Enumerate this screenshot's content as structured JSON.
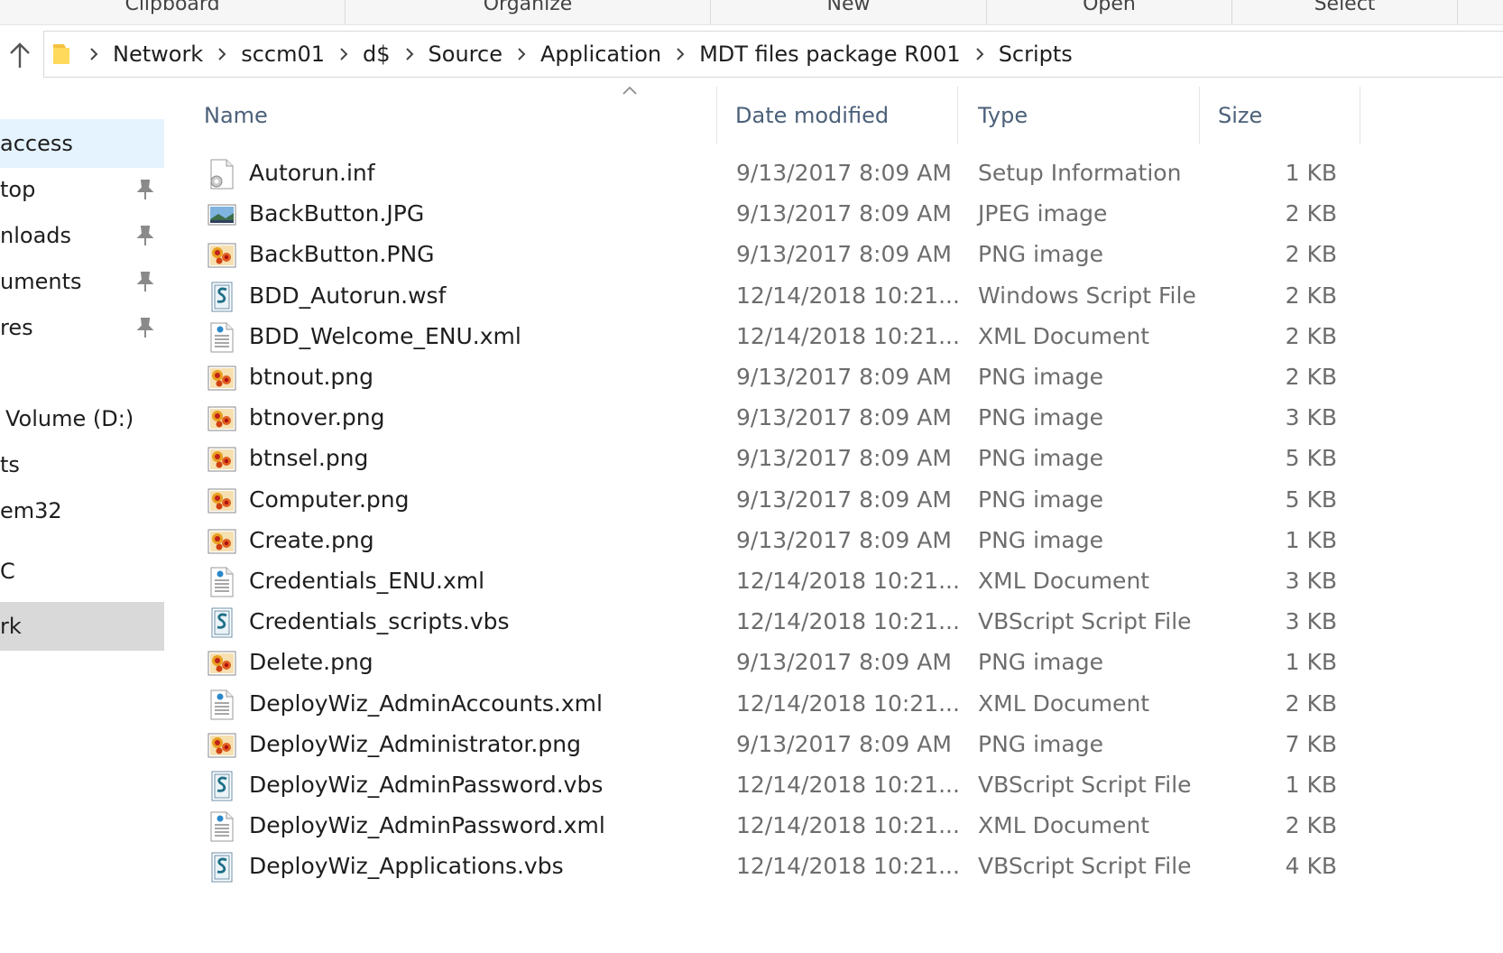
{
  "ribbon": {
    "groups": [
      "Clipboard",
      "Organize",
      "New",
      "Open",
      "Select"
    ]
  },
  "address": {
    "crumbs": [
      "Network",
      "sccm01",
      "d$",
      "Source",
      "Application",
      "MDT files package R001",
      "Scripts"
    ]
  },
  "navpane": {
    "items": [
      {
        "label": "access",
        "pinned": false,
        "state": "hover"
      },
      {
        "label": "top",
        "pinned": true,
        "state": ""
      },
      {
        "label": "nloads",
        "pinned": true,
        "state": ""
      },
      {
        "label": "uments",
        "pinned": true,
        "state": ""
      },
      {
        "label": "res",
        "pinned": true,
        "state": ""
      },
      {
        "label": "Volume (D:)",
        "pinned": false,
        "state": ""
      },
      {
        "label": "ts",
        "pinned": false,
        "state": ""
      },
      {
        "label": "em32",
        "pinned": false,
        "state": ""
      },
      {
        "label": "C",
        "pinned": false,
        "state": ""
      },
      {
        "label": "rk",
        "pinned": false,
        "state": "selected"
      }
    ]
  },
  "columns": {
    "name": "Name",
    "date": "Date modified",
    "type": "Type",
    "size": "Size"
  },
  "files": [
    {
      "name": "Autorun.inf",
      "date": "9/13/2017 8:09 AM",
      "type": "Setup Information",
      "size": "1 KB",
      "icon": "inf-file-icon"
    },
    {
      "name": "BackButton.JPG",
      "date": "9/13/2017 8:09 AM",
      "type": "JPEG image",
      "size": "2 KB",
      "icon": "jpeg-file-icon"
    },
    {
      "name": "BackButton.PNG",
      "date": "9/13/2017 8:09 AM",
      "type": "PNG image",
      "size": "2 KB",
      "icon": "png-file-icon"
    },
    {
      "name": "BDD_Autorun.wsf",
      "date": "12/14/2018 10:21...",
      "type": "Windows Script File",
      "size": "2 KB",
      "icon": "script-file-icon"
    },
    {
      "name": "BDD_Welcome_ENU.xml",
      "date": "12/14/2018 10:21...",
      "type": "XML Document",
      "size": "2 KB",
      "icon": "xml-file-icon"
    },
    {
      "name": "btnout.png",
      "date": "9/13/2017 8:09 AM",
      "type": "PNG image",
      "size": "2 KB",
      "icon": "png-file-icon"
    },
    {
      "name": "btnover.png",
      "date": "9/13/2017 8:09 AM",
      "type": "PNG image",
      "size": "3 KB",
      "icon": "png-file-icon"
    },
    {
      "name": "btnsel.png",
      "date": "9/13/2017 8:09 AM",
      "type": "PNG image",
      "size": "5 KB",
      "icon": "png-file-icon"
    },
    {
      "name": "Computer.png",
      "date": "9/13/2017 8:09 AM",
      "type": "PNG image",
      "size": "5 KB",
      "icon": "png-file-icon"
    },
    {
      "name": "Create.png",
      "date": "9/13/2017 8:09 AM",
      "type": "PNG image",
      "size": "1 KB",
      "icon": "png-file-icon"
    },
    {
      "name": "Credentials_ENU.xml",
      "date": "12/14/2018 10:21...",
      "type": "XML Document",
      "size": "3 KB",
      "icon": "xml-file-icon"
    },
    {
      "name": "Credentials_scripts.vbs",
      "date": "12/14/2018 10:21...",
      "type": "VBScript Script File",
      "size": "3 KB",
      "icon": "script-file-icon"
    },
    {
      "name": "Delete.png",
      "date": "9/13/2017 8:09 AM",
      "type": "PNG image",
      "size": "1 KB",
      "icon": "png-file-icon"
    },
    {
      "name": "DeployWiz_AdminAccounts.xml",
      "date": "12/14/2018 10:21...",
      "type": "XML Document",
      "size": "2 KB",
      "icon": "xml-file-icon"
    },
    {
      "name": "DeployWiz_Administrator.png",
      "date": "9/13/2017 8:09 AM",
      "type": "PNG image",
      "size": "7 KB",
      "icon": "png-file-icon"
    },
    {
      "name": "DeployWiz_AdminPassword.vbs",
      "date": "12/14/2018 10:21...",
      "type": "VBScript Script File",
      "size": "1 KB",
      "icon": "script-file-icon"
    },
    {
      "name": "DeployWiz_AdminPassword.xml",
      "date": "12/14/2018 10:21...",
      "type": "XML Document",
      "size": "2 KB",
      "icon": "xml-file-icon"
    },
    {
      "name": "DeployWiz_Applications.vbs",
      "date": "12/14/2018 10:21...",
      "type": "VBScript Script File",
      "size": "4 KB",
      "icon": "script-file-icon"
    }
  ]
}
